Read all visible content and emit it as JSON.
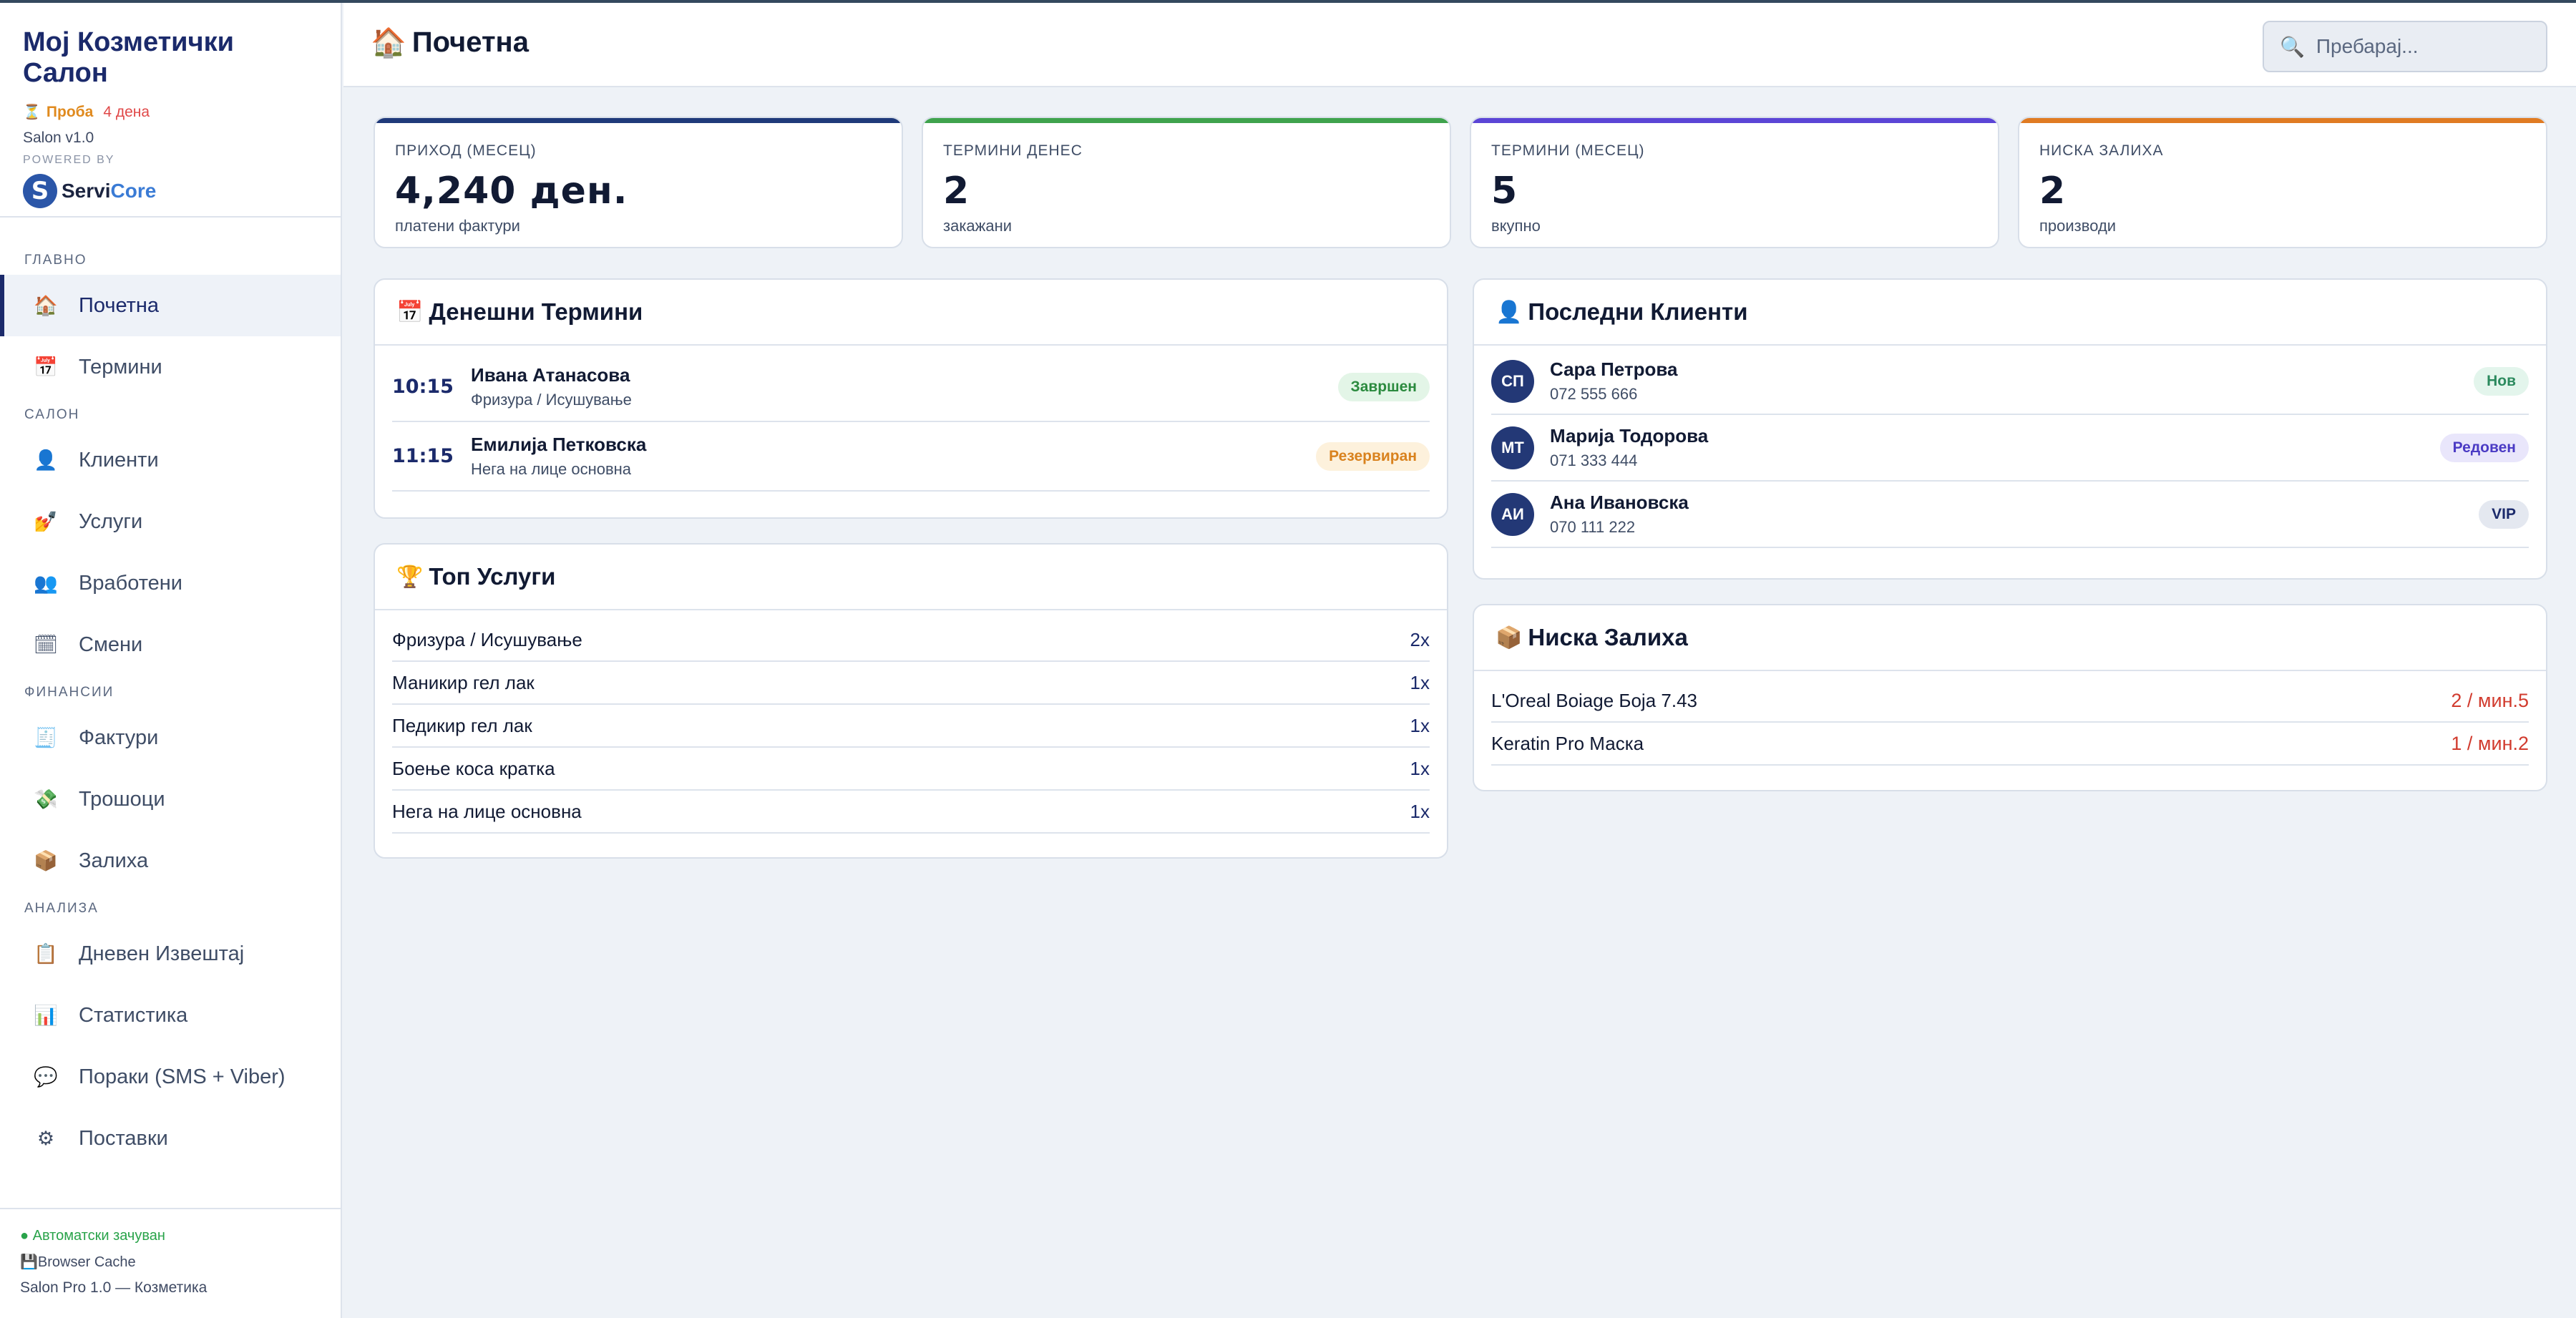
{
  "brand": {
    "title": "Мој Козметички Салон",
    "trial_label": "Проба",
    "trial_days": "4 дена",
    "version": "Salon v1.0",
    "powered_by": "POWERED BY",
    "logo_letter": "S",
    "logo_text_a": "Servi",
    "logo_text_b": "Core"
  },
  "nav": {
    "sections": [
      {
        "title": "ГЛАВНО",
        "items": [
          {
            "label": "Почетна",
            "icon": "home-icon",
            "glyph": "🏠",
            "active": true
          },
          {
            "label": "Термини",
            "icon": "calendar-icon",
            "glyph": "📅"
          }
        ]
      },
      {
        "title": "САЛОН",
        "items": [
          {
            "label": "Клиенти",
            "icon": "user-icon",
            "glyph": "👤"
          },
          {
            "label": "Услуги",
            "icon": "nail-polish-icon",
            "glyph": "💅"
          },
          {
            "label": "Вработени",
            "icon": "users-icon",
            "glyph": "👥"
          },
          {
            "label": "Смени",
            "icon": "calendar-page-icon",
            "glyph": "🗓"
          }
        ]
      },
      {
        "title": "ФИНАНСИИ",
        "items": [
          {
            "label": "Фактури",
            "icon": "receipt-icon",
            "glyph": "🧾"
          },
          {
            "label": "Трошоци",
            "icon": "money-icon",
            "glyph": "💸"
          },
          {
            "label": "Залиха",
            "icon": "package-icon",
            "glyph": "📦"
          }
        ]
      },
      {
        "title": "АНАЛИЗА",
        "items": [
          {
            "label": "Дневен Извештај",
            "icon": "report-icon",
            "glyph": "📋"
          },
          {
            "label": "Статистика",
            "icon": "chart-icon",
            "glyph": "📊"
          },
          {
            "label": "Пораки (SMS + Viber)",
            "icon": "chat-icon",
            "glyph": "💬"
          },
          {
            "label": "Поставки",
            "icon": "gear-icon",
            "glyph": "⚙"
          }
        ]
      }
    ]
  },
  "footer": {
    "autosave": "● Автоматски зачуван",
    "cache": "Browser Cache",
    "version": "Salon Pro 1.0 — Козметика"
  },
  "header": {
    "title": "Почетна",
    "search_placeholder": "Пребарај..."
  },
  "stats": [
    {
      "label": "ПРИХОД (МЕСЕЦ)",
      "value": "4,240 ден.",
      "sub": "платени фактури",
      "color": "#1f3a7a"
    },
    {
      "label": "ТЕРМИНИ ДЕНЕС",
      "value": "2",
      "sub": "закажани",
      "color": "#3fa34d"
    },
    {
      "label": "ТЕРМИНИ (МЕСЕЦ)",
      "value": "5",
      "sub": "вкупно",
      "color": "#5b45d6"
    },
    {
      "label": "НИСКА ЗАЛИХА",
      "value": "2",
      "sub": "производи",
      "color": "#e07b22"
    }
  ],
  "today": {
    "title": "Денешни Термини",
    "rows": [
      {
        "time": "10:15",
        "name": "Ивана Атанасова",
        "service": "Фризура / Исушување",
        "status": "Завршен",
        "status_bg": "#e3f5e7",
        "status_fg": "#2b8a3e"
      },
      {
        "time": "11:15",
        "name": "Емилија Петковска",
        "service": "Нега на лице основна",
        "status": "Резервиран",
        "status_bg": "#fdf1dc",
        "status_fg": "#d9821e"
      }
    ]
  },
  "top_services": {
    "title": "Топ Услуги",
    "rows": [
      {
        "name": "Фризура / Исушување",
        "count": "2x"
      },
      {
        "name": "Маникир гел лак",
        "count": "1x"
      },
      {
        "name": "Педикир гел лак",
        "count": "1x"
      },
      {
        "name": "Боење коса кратка",
        "count": "1x"
      },
      {
        "name": "Нега на лице основна",
        "count": "1x"
      }
    ]
  },
  "clients": {
    "title": "Последни Клиенти",
    "rows": [
      {
        "initials": "СП",
        "name": "Сара Петрова",
        "phone": "072 555 666",
        "tag": "Нов",
        "tag_bg": "#e3f5ec",
        "tag_fg": "#2b8a5e"
      },
      {
        "initials": "МТ",
        "name": "Марија Тодорова",
        "phone": "071 333 444",
        "tag": "Редовен",
        "tag_bg": "#e9e6fb",
        "tag_fg": "#4b3bc4"
      },
      {
        "initials": "АИ",
        "name": "Ана Ивановска",
        "phone": "070 111 222",
        "tag": "VIP",
        "tag_bg": "#e4e8f0",
        "tag_fg": "#1b2a6b"
      }
    ]
  },
  "low_stock": {
    "title": "Ниска Залиха",
    "rows": [
      {
        "name": "L'Oreal Boiage Боја 7.43",
        "qty": "2 / мин.5"
      },
      {
        "name": "Keratin Pro Маска",
        "qty": "1 / мин.2"
      }
    ]
  }
}
